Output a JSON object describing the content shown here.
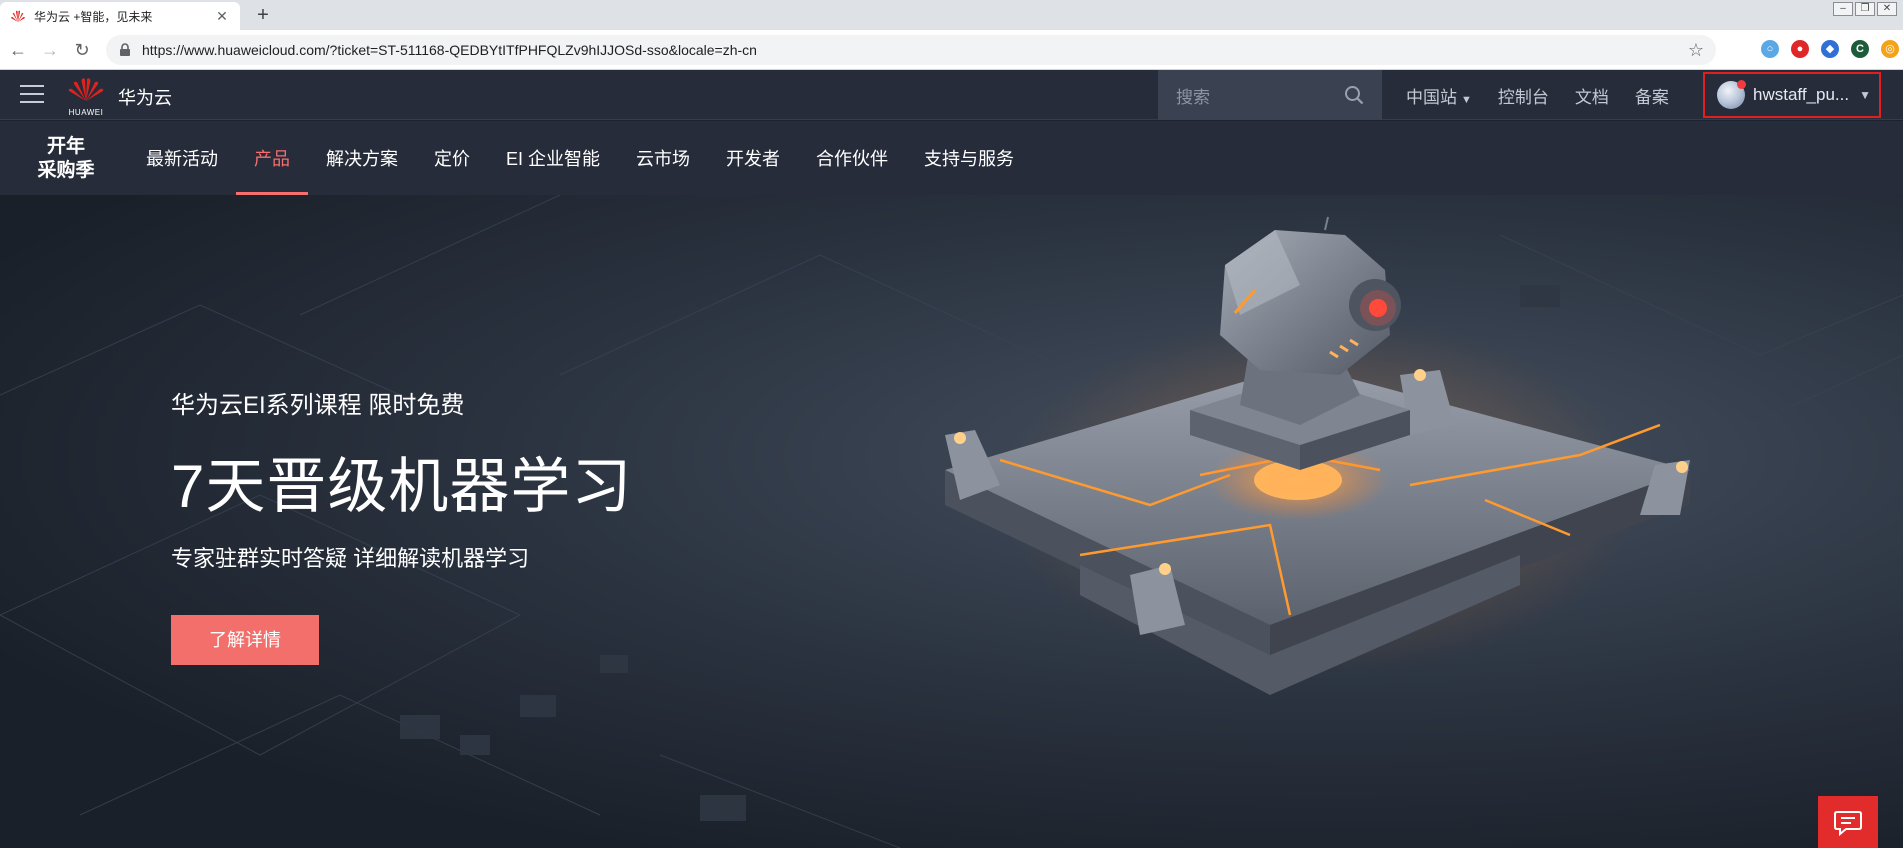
{
  "browser": {
    "tab_title": "华为云 +智能，见未来",
    "new_tab_symbol": "+",
    "close_symbol": "✕",
    "url": "https://www.huaweicloud.com/?ticket=ST-511168-QEDBYtITfPHFQLZv9hIJJOSd-sso&locale=zh-cn",
    "extensions": [
      {
        "name": "circle-ext",
        "color": "#5aa9e6",
        "glyph": "○"
      },
      {
        "name": "red-ext",
        "color": "#e02727",
        "glyph": "●"
      },
      {
        "name": "puzzle-ext",
        "color": "#2f6fd6",
        "glyph": "◆"
      },
      {
        "name": "c-ext",
        "color": "#1d5c3a",
        "glyph": "C"
      },
      {
        "name": "orange-ext",
        "color": "#f3a21b",
        "glyph": "◎"
      }
    ]
  },
  "header": {
    "logo_word": "HUAWEI",
    "brand": "华为云",
    "search_placeholder": "搜索",
    "links": [
      {
        "label": "中国站",
        "has_caret": true
      },
      {
        "label": "控制台"
      },
      {
        "label": "文档"
      },
      {
        "label": "备案"
      }
    ],
    "user": "hwstaff_pu...",
    "caret": "▼"
  },
  "prodnav": {
    "promo_line1": "开年",
    "promo_line2": "采购季",
    "items": [
      {
        "label": "最新活动"
      },
      {
        "label": "产品",
        "active": true
      },
      {
        "label": "解决方案"
      },
      {
        "label": "定价"
      },
      {
        "label": "EI 企业智能"
      },
      {
        "label": "云市场"
      },
      {
        "label": "开发者"
      },
      {
        "label": "合作伙伴"
      },
      {
        "label": "支持与服务"
      }
    ]
  },
  "hero": {
    "subtitle": "华为云EI系列课程 限时免费",
    "title": "7天晋级机器学习",
    "desc": "专家驻群实时答疑 详细解读机器学习",
    "cta": "了解详情"
  },
  "colors": {
    "accent": "#f66e6e",
    "cta": "#f36f6b",
    "chat": "#e22b2b",
    "nav_bg": "#262c3a"
  }
}
